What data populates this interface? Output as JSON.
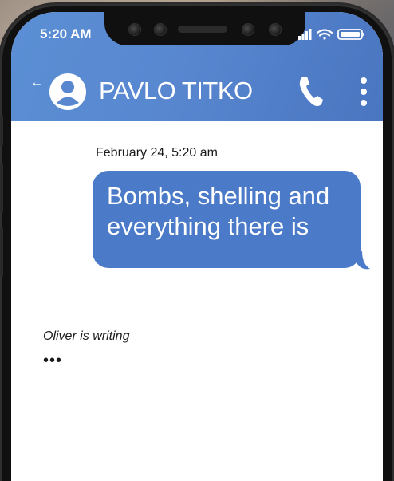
{
  "status_bar": {
    "time": "5:20 AM",
    "icons": [
      "signal-icon",
      "wifi-icon",
      "battery-icon"
    ]
  },
  "header": {
    "back_icon": "back-arrow-icon",
    "avatar_icon": "user-avatar-icon",
    "contact_name": "PAVLO TITKO",
    "call_icon": "phone-icon",
    "menu_icon": "more-vertical-icon"
  },
  "conversation": {
    "date": "February 24, 5:20 am",
    "messages": [
      {
        "text": "Bombs, shelling and everything there is"
      }
    ],
    "typing_label": "Oliver is writing",
    "typing_dots": "•••"
  },
  "colors": {
    "header": "#5887d0",
    "bubble": "#4b7bc8",
    "screen": "#ffffff",
    "phone_frame": "#101010"
  }
}
